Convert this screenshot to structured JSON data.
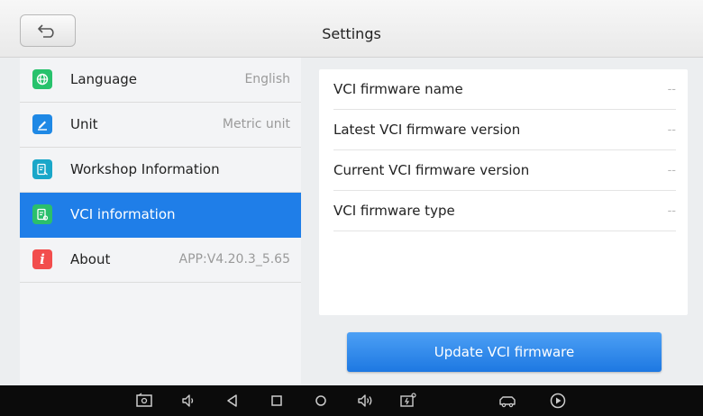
{
  "header": {
    "title": "Settings"
  },
  "sidebar": {
    "items": [
      {
        "label": "Language",
        "value": "English",
        "icon": "globe-icon",
        "color": "#27c26c"
      },
      {
        "label": "Unit",
        "value": "Metric unit",
        "icon": "pencil-icon",
        "color": "#1e88e5"
      },
      {
        "label": "Workshop Information",
        "value": "",
        "icon": "document-edit-icon",
        "color": "#1aa7c9"
      },
      {
        "label": "VCI information",
        "value": "",
        "icon": "document-chip-icon",
        "color": "#2bbf6b"
      },
      {
        "label": "About",
        "value": "APP:V4.20.3_5.65",
        "icon": "info-icon",
        "color": "#f24d4d"
      }
    ],
    "active_index": 3
  },
  "vci": {
    "rows": [
      {
        "label": "VCI firmware name",
        "value": "--"
      },
      {
        "label": "Latest VCI firmware version",
        "value": "--"
      },
      {
        "label": "Current VCI firmware version",
        "value": "--"
      },
      {
        "label": "VCI firmware type",
        "value": "--"
      }
    ],
    "update_label": "Update VCI firmware"
  },
  "navbar": {
    "icons": [
      "screenshot-icon",
      "volume-down-icon",
      "back-triangle-icon",
      "recent-apps-icon",
      "home-icon",
      "volume-up-icon",
      "battery-icon",
      "car-icon",
      "play-icon"
    ]
  },
  "colors": {
    "accent": "#1f7ee8",
    "header_bg": "#efefef",
    "navbar_bg": "#0b0b0b"
  }
}
